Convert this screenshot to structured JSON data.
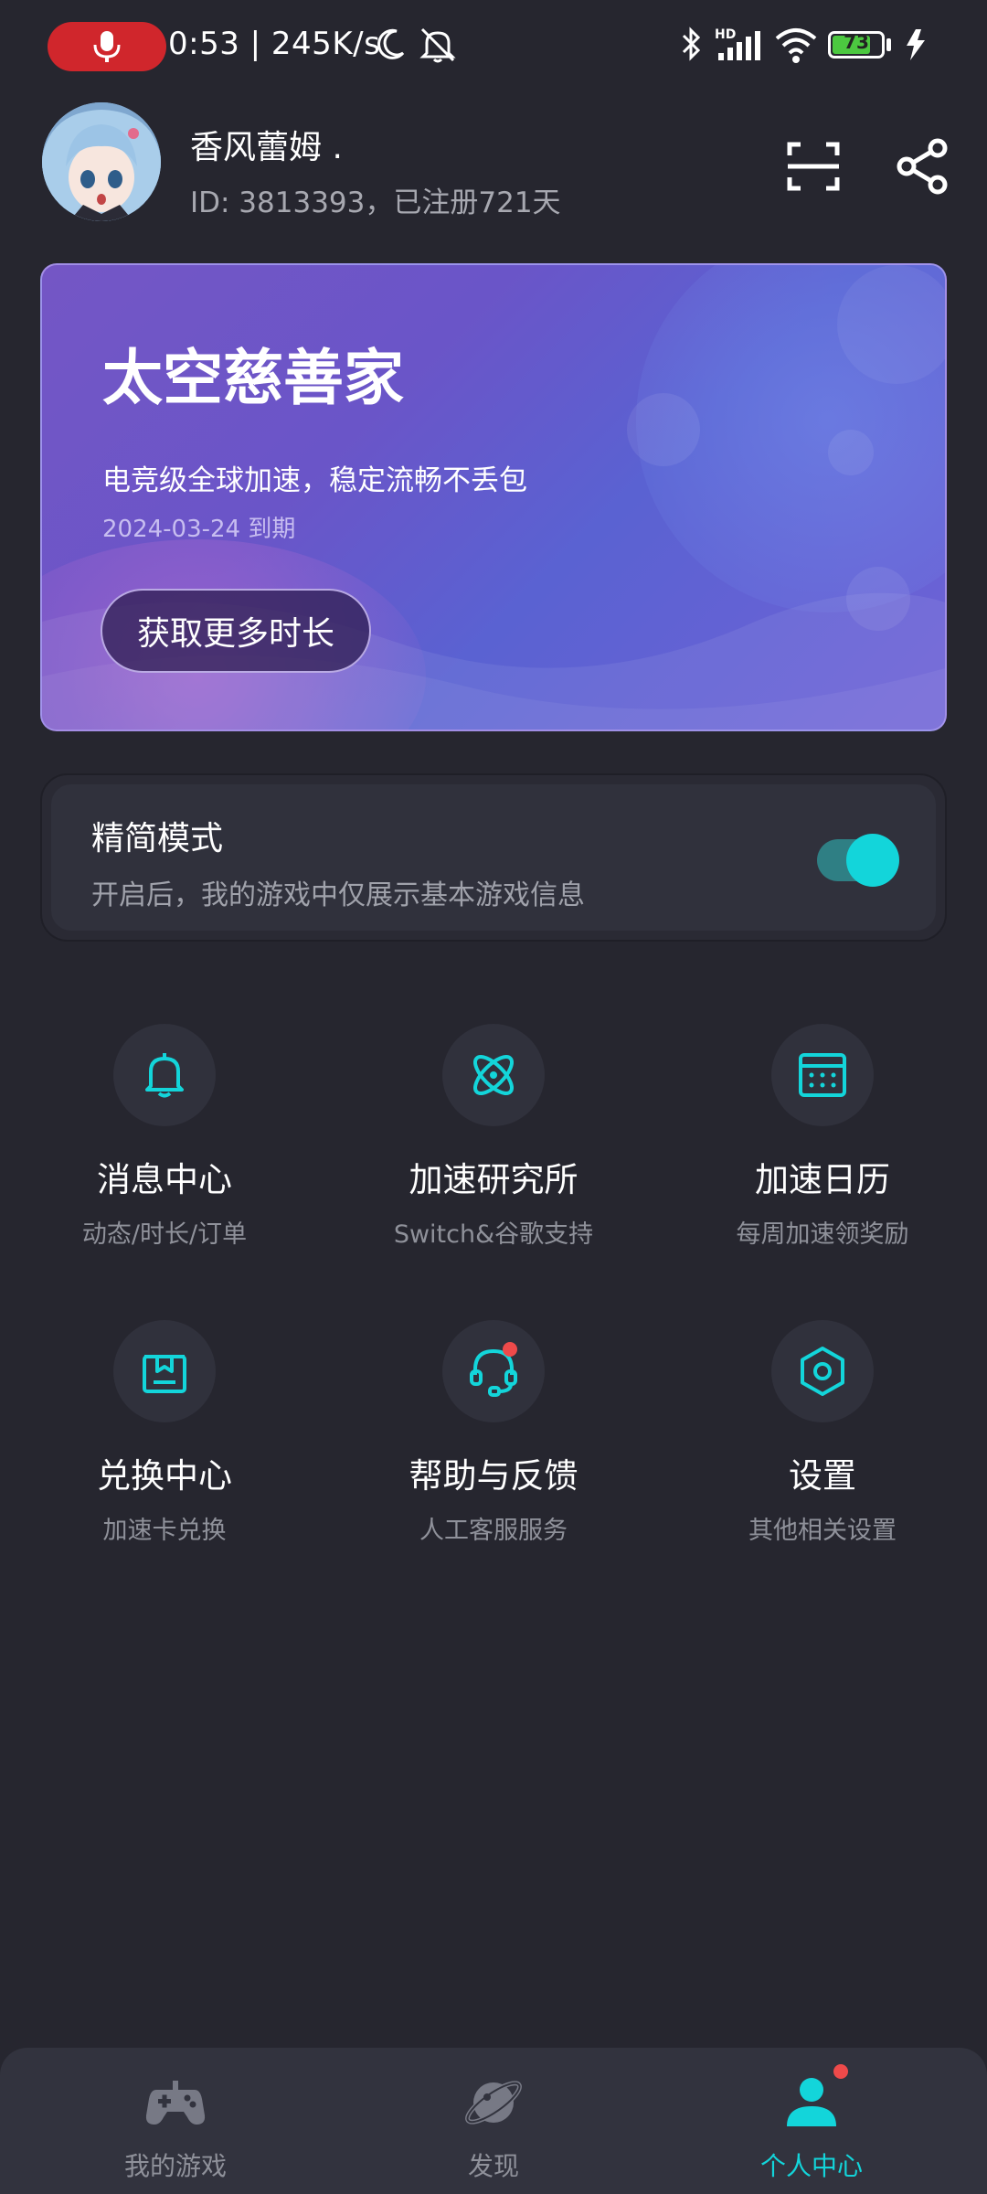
{
  "status_bar": {
    "time_speed": "0:53 | 245K/s",
    "battery": "73",
    "signal_badge": "HD"
  },
  "profile": {
    "username": "香风蕾姆 .",
    "user_id": "ID: 3813393，已注册721天"
  },
  "membership": {
    "title": "太空慈善家",
    "description": "电竞级全球加速，稳定流畅不丢包",
    "expiry": "2024-03-24 到期",
    "button": "获取更多时长"
  },
  "simple_mode": {
    "title": "精简模式",
    "description": "开启后，我的游戏中仅展示基本游戏信息",
    "enabled": true
  },
  "menu": [
    {
      "label": "消息中心",
      "sub": "动态/时长/订单",
      "icon": "bell-icon"
    },
    {
      "label": "加速研究所",
      "sub": "Switch&谷歌支持",
      "icon": "atom-icon"
    },
    {
      "label": "加速日历",
      "sub": "每周加速领奖励",
      "icon": "calendar-icon"
    },
    {
      "label": "兑换中心",
      "sub": "加速卡兑换",
      "icon": "gift-box-icon"
    },
    {
      "label": "帮助与反馈",
      "sub": "人工客服服务",
      "icon": "headset-icon"
    },
    {
      "label": "设置",
      "sub": "其他相关设置",
      "icon": "settings-hexagon-icon"
    }
  ],
  "bottom_nav": [
    {
      "label": "我的游戏",
      "icon": "gamepad-icon",
      "active": false
    },
    {
      "label": "发现",
      "icon": "planet-icon",
      "active": false
    },
    {
      "label": "个人中心",
      "icon": "person-icon",
      "active": true
    }
  ],
  "colors": {
    "background": "#26262f",
    "accent": "#13d5da",
    "card_purple": "#6a55c8",
    "badge_red": "#ee4a4a"
  }
}
